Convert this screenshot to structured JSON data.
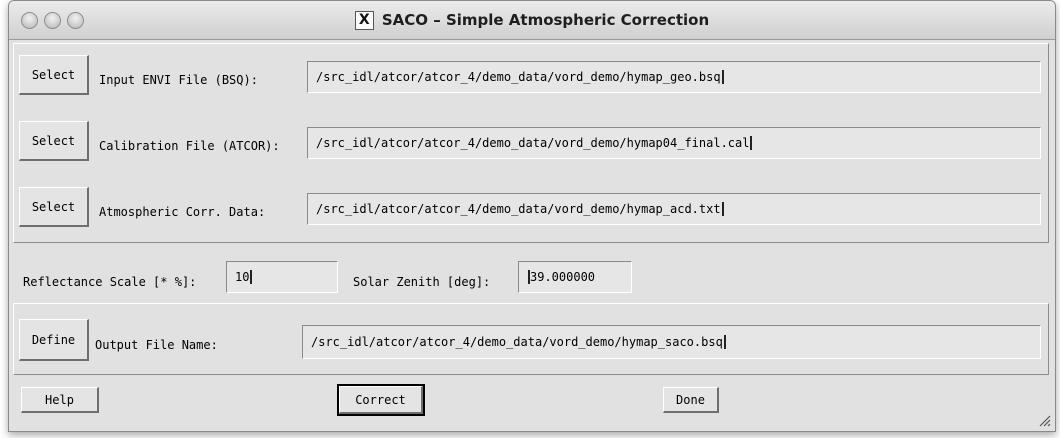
{
  "window": {
    "title": "SACO – Simple Atmospheric Correction",
    "x_glyph": "X"
  },
  "input_file": {
    "button": "Select",
    "label": "Input ENVI File (BSQ):",
    "value": "/src_idl/atcor/atcor_4/demo_data/vord_demo/hymap_geo.bsq"
  },
  "calibration_file": {
    "button": "Select",
    "label": "Calibration File (ATCOR):",
    "value": "/src_idl/atcor/atcor_4/demo_data/vord_demo/hymap04_final.cal"
  },
  "atm_data": {
    "button": "Select",
    "label": "Atmospheric Corr. Data:",
    "value": "/src_idl/atcor/atcor_4/demo_data/vord_demo/hymap_acd.txt"
  },
  "reflectance": {
    "label": "Reflectance Scale [* %]:",
    "value": "10"
  },
  "solar": {
    "label": "Solar Zenith [deg]:",
    "value": "39.000000"
  },
  "output": {
    "button": "Define",
    "label": "Output File Name:",
    "value": "/src_idl/atcor/atcor_4/demo_data/vord_demo/hymap_saco.bsq"
  },
  "actions": {
    "help": "Help",
    "correct": "Correct",
    "done": "Done"
  }
}
